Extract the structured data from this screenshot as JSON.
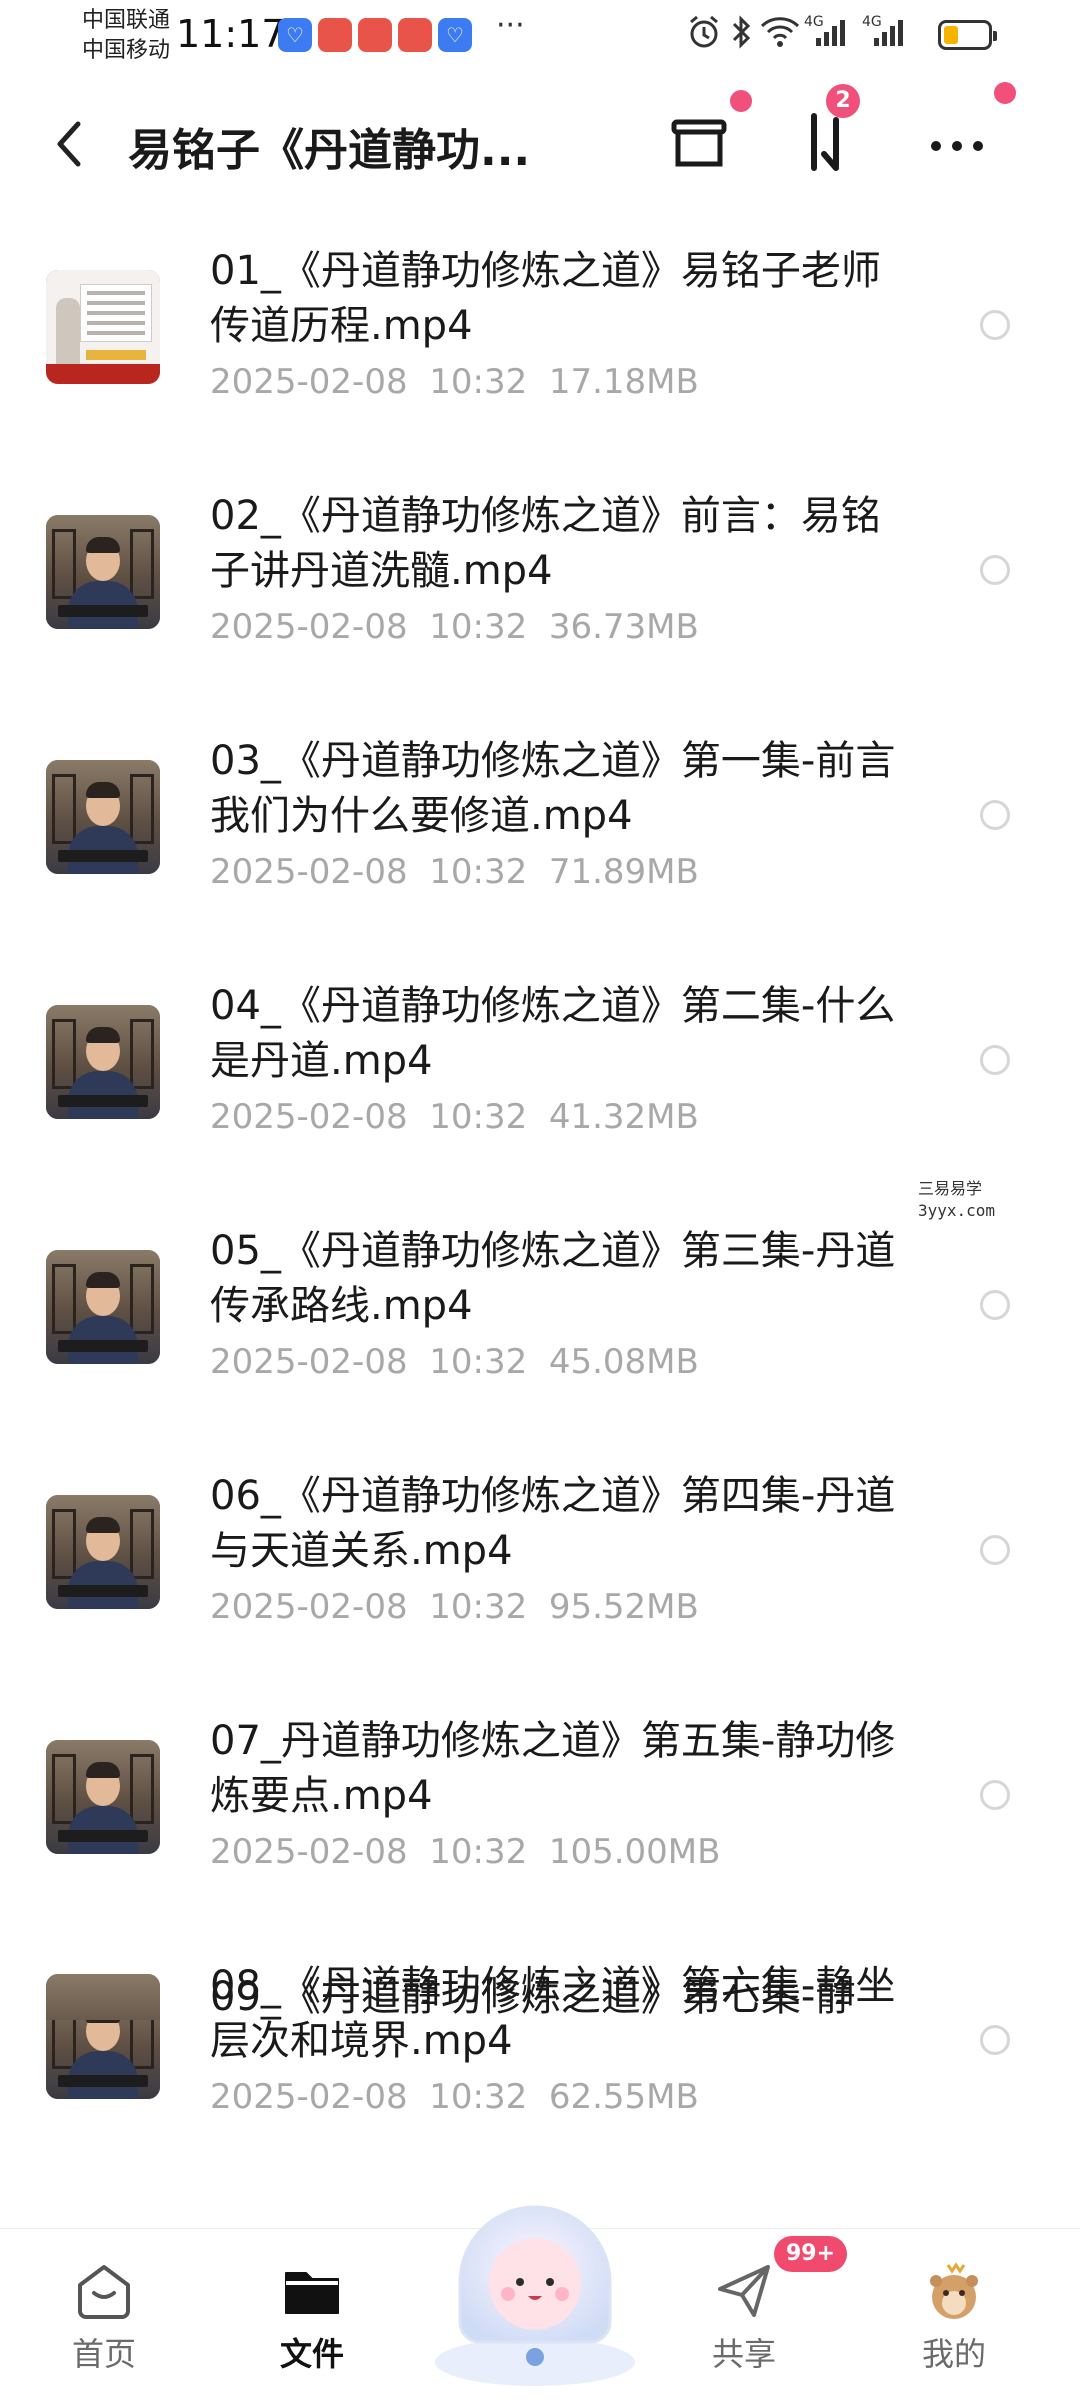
{
  "status_bar": {
    "carrier_1": "中国联通",
    "carrier_2": "中国移动",
    "time": "11:17",
    "more": "···",
    "network_1": "4G",
    "network_2": "4G"
  },
  "header": {
    "title": "易铭子《丹道静功..."
  },
  "header_badges": {
    "transfer_count": "2"
  },
  "files": [
    {
      "name": "01_《丹道静功修炼之道》易铭子老师传道历程.mp4",
      "date": "2025-02-08",
      "time": "10:32",
      "size": "17.18MB",
      "thumb": "slide"
    },
    {
      "name": "02_《丹道静功修炼之道》前言：易铭子讲丹道洗髓.mp4",
      "date": "2025-02-08",
      "time": "10:32",
      "size": "36.73MB",
      "thumb": "speaker"
    },
    {
      "name": "03_《丹道静功修炼之道》第一集-前言我们为什么要修道.mp4",
      "date": "2025-02-08",
      "time": "10:32",
      "size": "71.89MB",
      "thumb": "speaker"
    },
    {
      "name": "04_《丹道静功修炼之道》第二集-什么是丹道.mp4",
      "date": "2025-02-08",
      "time": "10:32",
      "size": "41.32MB",
      "thumb": "speaker"
    },
    {
      "name": "05_《丹道静功修炼之道》第三集-丹道传承路线.mp4",
      "date": "2025-02-08",
      "time": "10:32",
      "size": "45.08MB",
      "thumb": "speaker"
    },
    {
      "name": "06_《丹道静功修炼之道》第四集-丹道与天道关系.mp4",
      "date": "2025-02-08",
      "time": "10:32",
      "size": "95.52MB",
      "thumb": "speaker"
    },
    {
      "name": "07_丹道静功修炼之道》第五集-静功修炼要点.mp4",
      "date": "2025-02-08",
      "time": "10:32",
      "size": "105.00MB",
      "thumb": "speaker"
    },
    {
      "name": "08_《丹道静功修炼之道》第六集-静坐层次和境界.mp4",
      "date": "2025-02-08",
      "time": "10:32",
      "size": "62.55MB",
      "thumb": "speaker"
    }
  ],
  "partial_file": {
    "name": "09_《丹道静功修炼之道》第七集-静"
  },
  "watermark": {
    "line_1": "三易易学",
    "line_2": "3yyx.com"
  },
  "tabbar": {
    "home": "首页",
    "files": "文件",
    "share": "共享",
    "me": "我的",
    "share_badge": "99+"
  },
  "colors": {
    "accent_pink": "#f0507a",
    "meta_gray": "#a8a8a8",
    "text": "#1a1a1a"
  },
  "icons": [
    "back-icon",
    "cloud-box-icon",
    "transfer-sort-icon",
    "more-icon",
    "home-icon",
    "folder-icon",
    "assistant-mascot-icon",
    "share-icon",
    "avatar-icon"
  ]
}
